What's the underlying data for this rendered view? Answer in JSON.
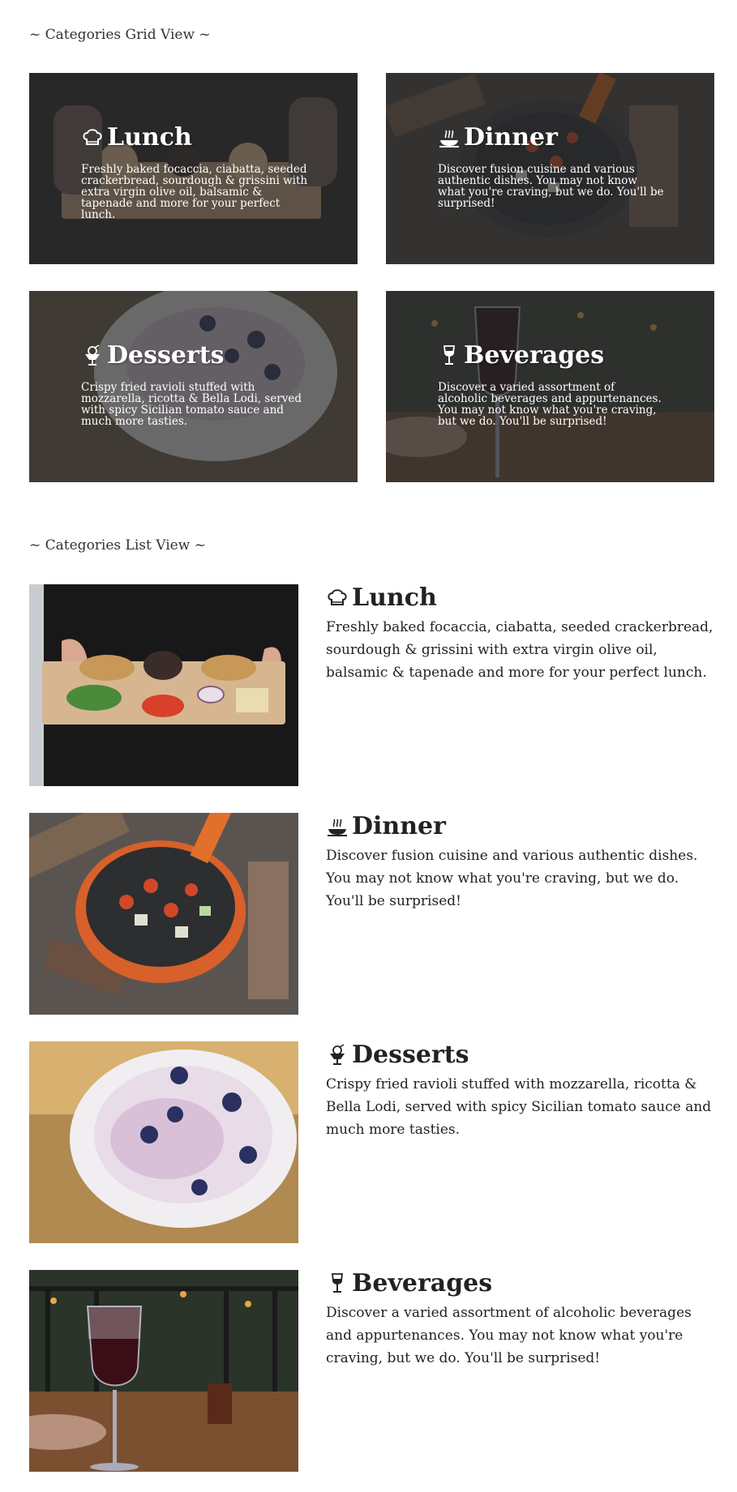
{
  "grid_title": "~ Categories Grid View ~",
  "list_title": "~ Categories List View ~",
  "categories": [
    {
      "title": "Lunch",
      "icon": "chef-hat-icon",
      "grid_desc": "Freshly baked focaccia, ciabatta, seeded crackerbread, sourdough & grissini with extra virgin olive oil, balsamic & tapenade and more for your perfect lunch.",
      "list_desc": "Freshly baked focaccia, ciabatta, seeded crackerbread, sourdough & grissini with extra virgin olive oil, balsamic & tapenade and more for your perfect lunch."
    },
    {
      "title": "Dinner",
      "icon": "steaming-dish-icon",
      "grid_desc": "Discover fusion cuisine and various authentic dishes. You may not know what you're craving, but we do. You'll be surprised!",
      "list_desc": "Discover fusion cuisine and various authentic dishes. You may not know what you're craving, but we do. You'll be surprised!"
    },
    {
      "title": "Desserts",
      "icon": "ice-cream-cup-icon",
      "grid_desc": "Crispy fried ravioli stuffed with mozzarella, ricotta & Bella Lodi, served with spicy Sicilian tomato sauce and much more tasties.",
      "list_desc": "Crispy fried ravioli stuffed with mozzarella, ricotta & Bella Lodi, served with spicy Sicilian tomato sauce and much more tasties."
    },
    {
      "title": "Beverages",
      "icon": "wine-glass-icon",
      "grid_desc": "Discover a varied assortment of alcoholic beverages and appurtenances. You may not know what you're craving, but we do. You'll be surprised!",
      "list_desc": "Discover a varied assortment of alcoholic beverages and appurtenances. You may not know what you're craving, but we do. You'll be surprised!"
    }
  ]
}
